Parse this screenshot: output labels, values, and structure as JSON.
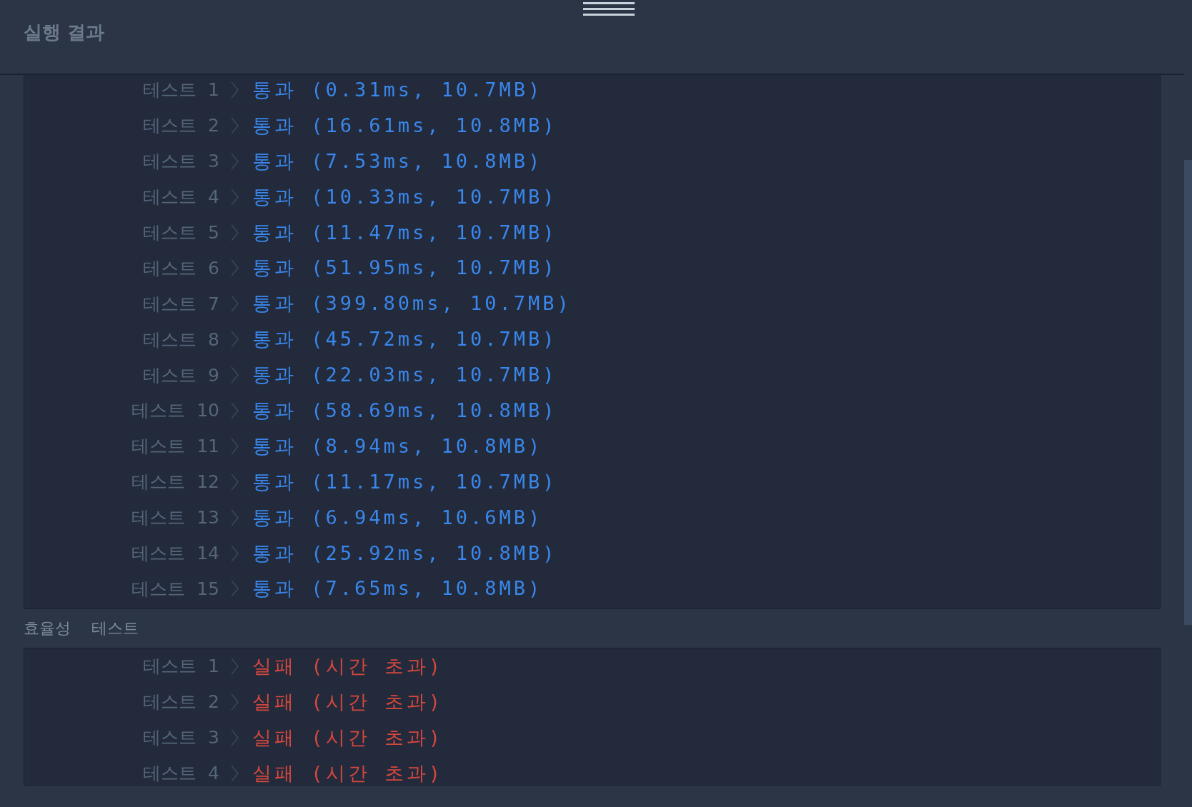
{
  "header": {
    "title": "실행 결과"
  },
  "accuracy_tests": {
    "rows": [
      {
        "label": "테스트 1",
        "result": "통과 (0.31ms, 10.7MB)",
        "kind": "pass"
      },
      {
        "label": "테스트 2",
        "result": "통과 (16.61ms, 10.8MB)",
        "kind": "pass"
      },
      {
        "label": "테스트 3",
        "result": "통과 (7.53ms, 10.8MB)",
        "kind": "pass"
      },
      {
        "label": "테스트 4",
        "result": "통과 (10.33ms, 10.7MB)",
        "kind": "pass"
      },
      {
        "label": "테스트 5",
        "result": "통과 (11.47ms, 10.7MB)",
        "kind": "pass"
      },
      {
        "label": "테스트 6",
        "result": "통과 (51.95ms, 10.7MB)",
        "kind": "pass"
      },
      {
        "label": "테스트 7",
        "result": "통과 (399.80ms, 10.7MB)",
        "kind": "pass"
      },
      {
        "label": "테스트 8",
        "result": "통과 (45.72ms, 10.7MB)",
        "kind": "pass"
      },
      {
        "label": "테스트 9",
        "result": "통과 (22.03ms, 10.7MB)",
        "kind": "pass"
      },
      {
        "label": "테스트 10",
        "result": "통과 (58.69ms, 10.8MB)",
        "kind": "pass"
      },
      {
        "label": "테스트 11",
        "result": "통과 (8.94ms, 10.8MB)",
        "kind": "pass"
      },
      {
        "label": "테스트 12",
        "result": "통과 (11.17ms, 10.7MB)",
        "kind": "pass"
      },
      {
        "label": "테스트 13",
        "result": "통과 (6.94ms, 10.6MB)",
        "kind": "pass"
      },
      {
        "label": "테스트 14",
        "result": "통과 (25.92ms, 10.8MB)",
        "kind": "pass"
      },
      {
        "label": "테스트 15",
        "result": "통과 (7.65ms, 10.8MB)",
        "kind": "pass"
      }
    ]
  },
  "efficiency_tests": {
    "label": "효율성 테스트",
    "rows": [
      {
        "label": "테스트 1",
        "result": "실패 (시간 초과)",
        "kind": "fail"
      },
      {
        "label": "테스트 2",
        "result": "실패 (시간 초과)",
        "kind": "fail"
      },
      {
        "label": "테스트 3",
        "result": "실패 (시간 초과)",
        "kind": "fail"
      },
      {
        "label": "테스트 4",
        "result": "실패 (시간 초과)",
        "kind": "fail"
      }
    ]
  }
}
